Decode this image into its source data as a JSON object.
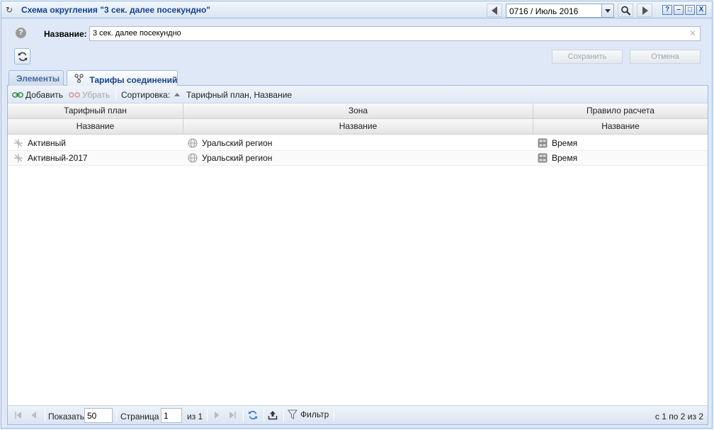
{
  "window": {
    "title": "Схема округления \"3 сек. далее посекундно\"",
    "period_value": "0716 / Июль 2016",
    "buttons": {
      "help": "?",
      "minimize": "–",
      "maximize": "□",
      "close": "X"
    }
  },
  "form": {
    "name_label": "Название:",
    "name_value": "3 сек. далее посекундно",
    "save_label": "Сохранить",
    "cancel_label": "Отмена"
  },
  "tabs": [
    {
      "label": "Элементы",
      "active": false
    },
    {
      "label": "Тарифы соединений",
      "active": true
    }
  ],
  "toolbar": {
    "add_label": "Добавить",
    "remove_label": "Убрать",
    "sort_label": "Сортировка:",
    "sort_value": "Тарифный план, Название"
  },
  "grid": {
    "group_headers": [
      "Тарифный план",
      "Зона",
      "Правило расчета"
    ],
    "column_headers": [
      "Название",
      "Название",
      "Название"
    ],
    "rows": [
      {
        "plan": "Активный",
        "zone": "Уральский регион",
        "rule": "Время"
      },
      {
        "plan": "Активный-2017",
        "zone": "Уральский регион",
        "rule": "Время"
      }
    ]
  },
  "pager": {
    "show_label": "Показать",
    "page_size": "50",
    "page_label": "Страница",
    "page_value": "1",
    "of_label": "из 1",
    "filter_label": "Фильтр",
    "summary": "с 1 по 2 из 2"
  },
  "colors": {
    "accent": "#15428b",
    "border": "#99bbe8",
    "panel_bg": "#dfe8f6"
  }
}
